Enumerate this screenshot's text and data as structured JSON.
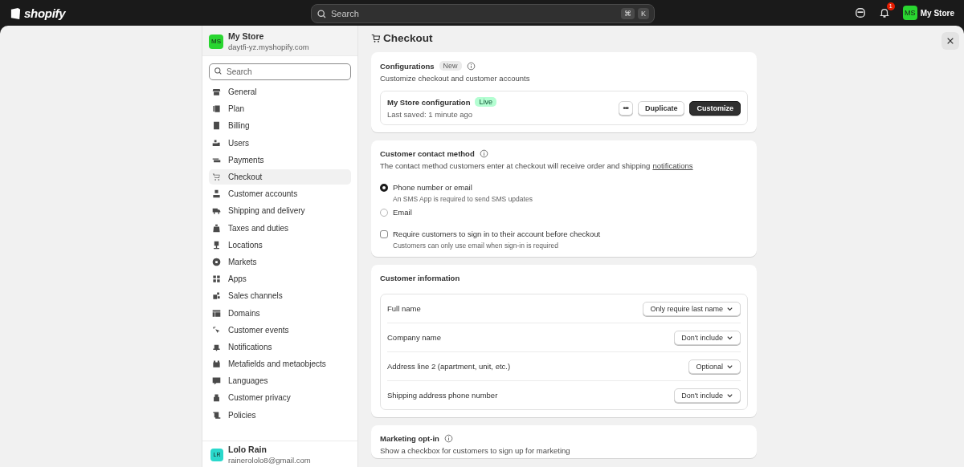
{
  "topbar": {
    "logo": "shopify",
    "search": {
      "placeholder": "Search",
      "keys": [
        "⌘",
        "K"
      ]
    },
    "notification_count": "1",
    "avatar": "MS",
    "store": "My Store"
  },
  "sidebar": {
    "store": {
      "avatar": "MS",
      "name": "My Store",
      "domain": "daytfi-yz.myshopify.com"
    },
    "search": {
      "placeholder": "Search"
    },
    "items": [
      {
        "label": "General",
        "selected": false
      },
      {
        "label": "Plan",
        "selected": false
      },
      {
        "label": "Billing",
        "selected": false
      },
      {
        "label": "Users",
        "selected": false
      },
      {
        "label": "Payments",
        "selected": false
      },
      {
        "label": "Checkout",
        "selected": true
      },
      {
        "label": "Customer accounts",
        "selected": false
      },
      {
        "label": "Shipping and delivery",
        "selected": false
      },
      {
        "label": "Taxes and duties",
        "selected": false
      },
      {
        "label": "Locations",
        "selected": false
      },
      {
        "label": "Markets",
        "selected": false
      },
      {
        "label": "Apps",
        "selected": false
      },
      {
        "label": "Sales channels",
        "selected": false
      },
      {
        "label": "Domains",
        "selected": false
      },
      {
        "label": "Customer events",
        "selected": false
      },
      {
        "label": "Notifications",
        "selected": false
      },
      {
        "label": "Metafields and metaobjects",
        "selected": false
      },
      {
        "label": "Languages",
        "selected": false
      },
      {
        "label": "Customer privacy",
        "selected": false
      },
      {
        "label": "Policies",
        "selected": false
      }
    ],
    "user": {
      "avatar": "LR",
      "name": "Lolo Rain",
      "email": "rainerololo8@gmail.com"
    }
  },
  "page": {
    "title": "Checkout",
    "configurations": {
      "title": "Configurations",
      "badge": "New",
      "subtitle": "Customize checkout and customer accounts",
      "config": {
        "name": "My Store configuration",
        "status": "Live",
        "saved": "Last saved: 1 minute ago",
        "more": "•••",
        "buttons": [
          "Duplicate",
          "Customize"
        ]
      }
    },
    "contact": {
      "title": "Customer contact method",
      "description": "The contact method customers enter at checkout will receive order and shipping",
      "link": "notifications",
      "options": [
        {
          "label": "Phone number or email",
          "help": "An SMS App is required to send SMS updates",
          "selected": true
        },
        {
          "label": "Email",
          "selected": false
        }
      ],
      "require_sign_in": {
        "label": "Require customers to sign in to their account before checkout",
        "help": "Customers can only use email when sign-in is required",
        "checked": false
      }
    },
    "customer_information": {
      "title": "Customer information",
      "rows": [
        {
          "label": "Full name",
          "value": "Only require last name"
        },
        {
          "label": "Company name",
          "value": "Don't include"
        },
        {
          "label": "Address line 2 (apartment, unit, etc.)",
          "value": "Optional"
        },
        {
          "label": "Shipping address phone number",
          "value": "Don't include"
        }
      ]
    },
    "marketing": {
      "title": "Marketing opt-in",
      "description": "Show a checkbox for customers to sign up for marketing"
    }
  }
}
